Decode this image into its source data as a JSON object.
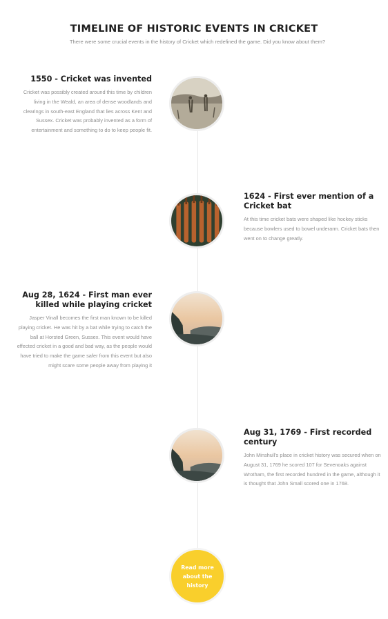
{
  "header": {
    "title": "TIMELINE OF HISTORIC EVENTS IN CRICKET",
    "subtitle": "There were some crucial events in the history of Cricket which redefined the game. Did you know about them?"
  },
  "events": [
    {
      "title": "1550 - Cricket was invented",
      "description": "Cricket was possibly created around this time by children living in the Weald, an area of dense woodlands and clearings in south-east England that lies across Kent and Sussex. Cricket was probably invented as a form of entertainment and something to do to keep people fit."
    },
    {
      "title": "1624 - First ever mention of a Cricket bat",
      "description": "At this time cricket bats were shaped like hockey sticks because bowlers used to bowel underarm. Cricket bats then went on to change greatly."
    },
    {
      "title": "Aug 28, 1624 - First man ever killed while playing cricket",
      "description": "Jasper Vinall becomes the first man known to be killed playing cricket. He was hit by a bat while trying to catch the ball at Horsted Green, Sussex. This event would have effected cricket in a good and bad way, as the people would have tried to make the game safer from this event but also might scare some people away from playing it"
    },
    {
      "title": "Aug 31, 1769 - First recorded century",
      "description": "John Minshull's place in cricket history was secured when on August 31, 1769 he scored 107 for Sevenoaks against Wrotham, the first recorded hundred in the game, although it is thought that John Small scored one in 1768."
    }
  ],
  "cta": {
    "label": "Read more about the history"
  },
  "colors": {
    "accent": "#f9cf2c",
    "title": "#1f1f1f",
    "body": "#8f8f8f",
    "line": "#e6e6e6"
  }
}
